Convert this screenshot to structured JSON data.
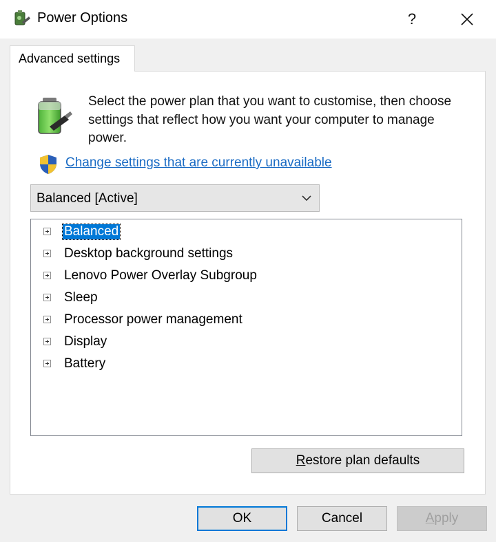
{
  "window": {
    "title": "Power Options",
    "help_label": "?",
    "icons": {
      "app": "power-options-icon",
      "close": "close-icon"
    }
  },
  "tab": {
    "label": "Advanced settings"
  },
  "intro": {
    "text": "Select the power plan that you want to customise, then choose settings that reflect how you want your computer to manage power.",
    "icon": "battery-icon"
  },
  "change_link": {
    "label": "Change settings that are currently unavailable",
    "icon": "shield-icon"
  },
  "plan_select": {
    "value": "Balanced [Active]"
  },
  "tree": {
    "items": [
      {
        "label": "Balanced",
        "selected": true
      },
      {
        "label": "Desktop background settings"
      },
      {
        "label": "Lenovo Power Overlay Subgroup"
      },
      {
        "label": "Sleep"
      },
      {
        "label": "Processor power management"
      },
      {
        "label": "Display"
      },
      {
        "label": "Battery"
      }
    ]
  },
  "buttons": {
    "restore": {
      "mnemonic": "R",
      "rest": "estore plan defaults"
    },
    "ok": "OK",
    "cancel": "Cancel",
    "apply": {
      "mnemonic": "A",
      "rest": "pply"
    }
  },
  "colors": {
    "link": "#1a6bc4",
    "selection": "#0078d7",
    "default_button_border": "#0078d7"
  }
}
